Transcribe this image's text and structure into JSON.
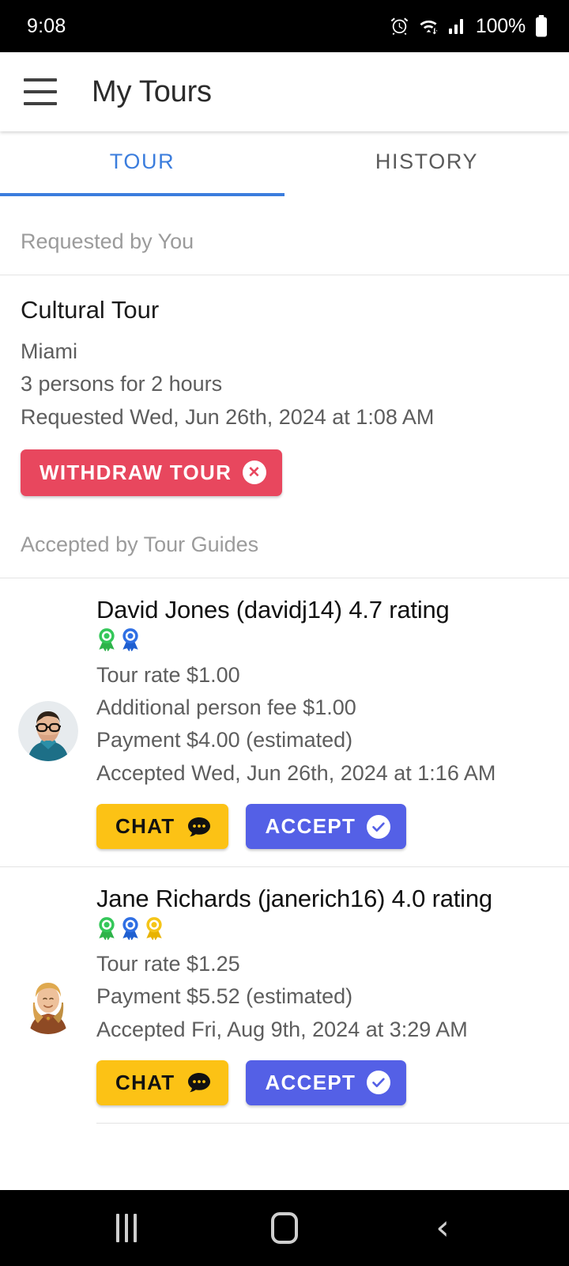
{
  "status_bar": {
    "time": "9:08",
    "battery_percent": "100%",
    "icons": [
      "alarm-icon",
      "wifi-icon",
      "cellular-signal-icon",
      "battery-icon"
    ]
  },
  "app_bar": {
    "menu_icon": "hamburger-menu-icon",
    "title": "My Tours"
  },
  "tabs": {
    "items": [
      {
        "label": "TOUR",
        "active": true
      },
      {
        "label": "HISTORY",
        "active": false
      }
    ],
    "accent_color": "#3b7ddd"
  },
  "requested_section": {
    "header": "Requested by You",
    "tour": {
      "title": "Cultural Tour",
      "city": "Miami",
      "party": "3 persons for 2 hours",
      "requested": "Requested Wed, Jun 26th, 2024 at 1:08 AM",
      "withdraw_label": "WITHDRAW TOUR",
      "withdraw_icon": "circle-x-icon",
      "withdraw_color": "#e8475e"
    }
  },
  "accepted_section": {
    "header": "Accepted by Tour Guides",
    "guides": [
      {
        "name": "David Jones (davidj14) 4.7 rating",
        "avatar": "man-with-glasses-avatar",
        "badges": [
          "green",
          "blue"
        ],
        "lines": [
          "Tour rate $1.00",
          "Additional person fee $1.00",
          "Payment $4.00 (estimated)",
          "Accepted Wed, Jun 26th, 2024 at 1:16 AM"
        ],
        "chat_label": "CHAT",
        "accept_label": "ACCEPT"
      },
      {
        "name": "Jane Richards (janerich16) 4.0 rating",
        "avatar": "blonde-woman-avatar",
        "badges": [
          "green",
          "blue",
          "yellow"
        ],
        "lines": [
          "Tour rate $1.25",
          "Payment $5.52 (estimated)",
          "Accepted Fri, Aug 9th, 2024 at 3:29 AM"
        ],
        "chat_label": "CHAT",
        "accept_label": "ACCEPT"
      }
    ],
    "chat_color": "#fcc215",
    "accept_color": "#5460e6"
  },
  "nav_bar": {
    "recents": "recents-icon",
    "home": "home-icon",
    "back": "back-icon"
  }
}
